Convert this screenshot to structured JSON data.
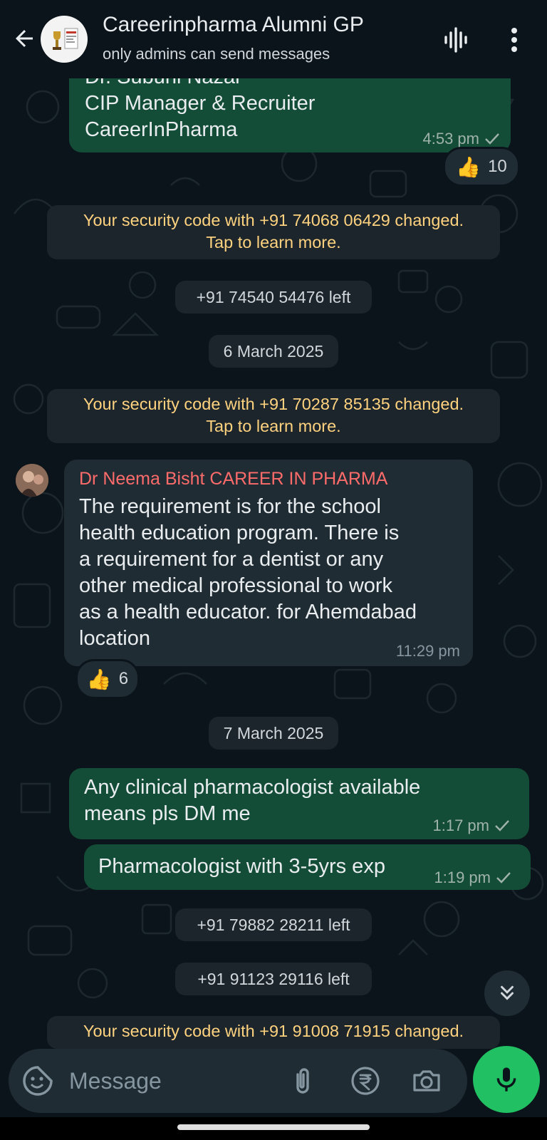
{
  "header": {
    "title": "Careerinpharma Alumni GP",
    "subtitle": "only admins can send messages"
  },
  "messages": {
    "m1": {
      "line0": "Dr. Subuhi Nazar",
      "line1": "CIP Manager & Recruiter",
      "line2": "CareerInPharma",
      "time": "4:53 pm",
      "reaction_count": "10"
    },
    "security1": {
      "line1": "Your security code with +91 74068 06429 changed.",
      "line2": "Tap to learn more."
    },
    "left1": "+91 74540 54476 left",
    "date1": "6 March 2025",
    "security2": {
      "line1": "Your security code with +91 70287 85135 changed.",
      "line2": "Tap to learn more."
    },
    "m2": {
      "sender": "Dr Neema Bisht CAREER IN PHARMA",
      "lines": [
        "The requirement is for the school",
        "health education program. There is",
        "a requirement for a dentist or any",
        "other medical professional to work",
        "as a health educator. for Ahemdabad",
        "location"
      ],
      "time": "11:29 pm",
      "reaction_count": "6"
    },
    "date2": "7 March 2025",
    "m3": {
      "line1": "Any clinical pharmacologist  available",
      "line2": "means pls DM me",
      "time": "1:17 pm"
    },
    "m4": {
      "text": "Pharmacologist with 3-5yrs exp",
      "time": "1:19 pm"
    },
    "left2": "+91 79882 28211 left",
    "left3": "+91 91123 29116 left",
    "security3": {
      "line1": "Your security code with +91 91008 71915 changed."
    }
  },
  "input": {
    "placeholder": "Message"
  },
  "icons": {
    "back": "arrow-left-icon",
    "voice_chat": "voice-chat-icon",
    "menu": "more-vert-icon",
    "emoji": "sticker-icon",
    "attach": "paperclip-icon",
    "payment": "rupee-icon",
    "camera": "camera-icon",
    "mic": "microphone-icon",
    "scroll": "double-chevron-down-icon"
  },
  "colors": {
    "background": "#0b141a",
    "outgoing_bubble": "#144d37",
    "incoming_bubble": "#202c33",
    "security_text": "#ffd27f",
    "sender_name": "#fd6b6b",
    "accent_green": "#21c063"
  }
}
